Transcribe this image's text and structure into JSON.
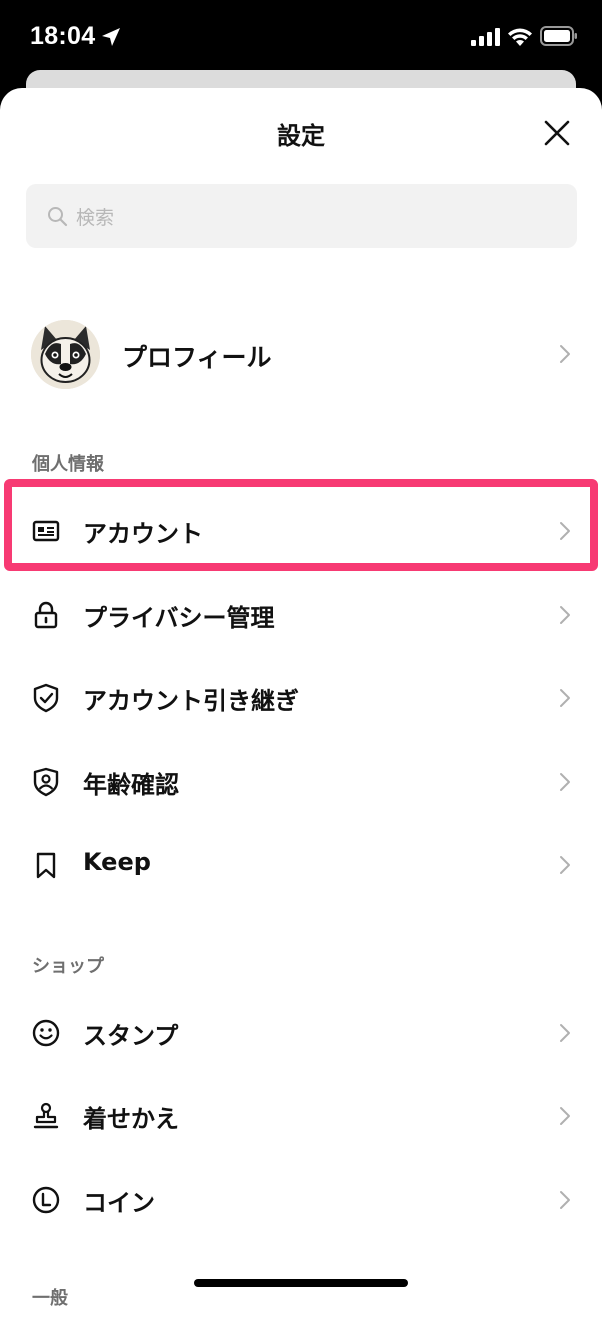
{
  "status": {
    "time": "18:04"
  },
  "sheet": {
    "title": "設定"
  },
  "search": {
    "placeholder": "検索"
  },
  "profile": {
    "label": "プロフィール"
  },
  "sections": {
    "personal": {
      "header": "個人情報",
      "items": [
        {
          "label": "アカウント",
          "icon": "id-card-icon"
        },
        {
          "label": "プライバシー管理",
          "icon": "lock-icon"
        },
        {
          "label": "アカウント引き継ぎ",
          "icon": "shield-check-icon"
        },
        {
          "label": "年齢確認",
          "icon": "person-shield-icon"
        },
        {
          "label": "Keep",
          "icon": "bookmark-icon"
        }
      ]
    },
    "shop": {
      "header": "ショップ",
      "items": [
        {
          "label": "スタンプ",
          "icon": "smiley-icon"
        },
        {
          "label": "着せかえ",
          "icon": "stamp-icon"
        },
        {
          "label": "コイン",
          "icon": "coin-icon"
        }
      ]
    },
    "general": {
      "header": "一般"
    }
  },
  "colors": {
    "highlight": "#f73a73",
    "sheet_background": "#ffffff",
    "search_background": "#f2f2f2",
    "section_header": "#6f6f6f"
  }
}
